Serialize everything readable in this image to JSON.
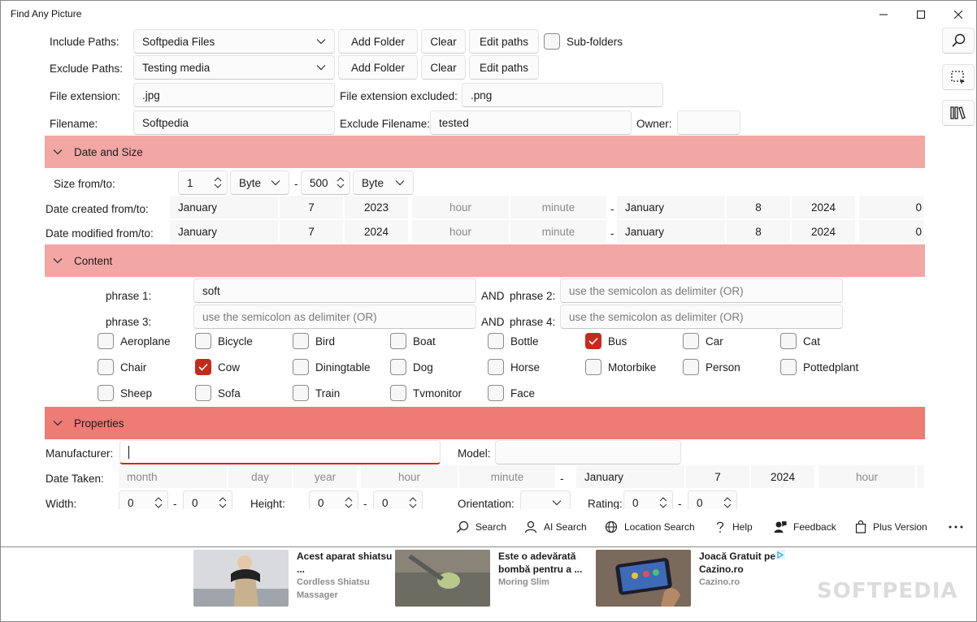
{
  "app": {
    "title": "Find Any Picture"
  },
  "paths": {
    "include_label": "Include Paths:",
    "include_value": "Softpedia Files",
    "exclude_label": "Exclude Paths:",
    "exclude_value": "Testing media",
    "add_folder": "Add Folder",
    "clear": "Clear",
    "edit_paths": "Edit paths",
    "subfolders": "Sub-folders"
  },
  "filters": {
    "ext_label": "File extension:",
    "ext_value": ".jpg",
    "ext_excl_label": "File extension excluded:",
    "ext_excl_value": ".png",
    "filename_label": "Filename:",
    "filename_value": "Softpedia",
    "excl_filename_label": "Exclude Filename:",
    "excl_filename_value": "tested",
    "owner_label": "Owner:",
    "owner_value": ""
  },
  "date_size": {
    "header": "Date and Size",
    "size_label": "Size from/to:",
    "size_from": "1",
    "size_from_unit": "Byte",
    "size_to": "500",
    "size_to_unit": "Byte",
    "dash": "-",
    "created_label": "Date created from/to:",
    "created_from": {
      "month": "January",
      "day": "7",
      "year": "2023",
      "hour": "hour",
      "minute": "minute"
    },
    "created_to": {
      "month": "January",
      "day": "8",
      "year": "2024",
      "hour": "0"
    },
    "modified_label": "Date modified from/to:",
    "modified_from": {
      "month": "January",
      "day": "7",
      "year": "2024",
      "hour": "hour",
      "minute": "minute"
    },
    "modified_to": {
      "month": "January",
      "day": "8",
      "year": "2024",
      "hour": "0"
    }
  },
  "content": {
    "header": "Content",
    "phrase1_label": "phrase 1:",
    "phrase1_value": "soft",
    "and_label": "AND",
    "phrase2_label": "phrase 2:",
    "phrase3_label": "phrase 3:",
    "phrase4_label": "phrase 4:",
    "placeholder": "use the semicolon as delimiter (OR)",
    "objects": [
      {
        "label": "Aeroplane",
        "checked": false
      },
      {
        "label": "Bicycle",
        "checked": false
      },
      {
        "label": "Bird",
        "checked": false
      },
      {
        "label": "Boat",
        "checked": false
      },
      {
        "label": "Bottle",
        "checked": false
      },
      {
        "label": "Bus",
        "checked": true
      },
      {
        "label": "Car",
        "checked": false
      },
      {
        "label": "Cat",
        "checked": false
      },
      {
        "label": "Chair",
        "checked": false
      },
      {
        "label": "Cow",
        "checked": true
      },
      {
        "label": "Diningtable",
        "checked": false
      },
      {
        "label": "Dog",
        "checked": false
      },
      {
        "label": "Horse",
        "checked": false
      },
      {
        "label": "Motorbike",
        "checked": false
      },
      {
        "label": "Person",
        "checked": false
      },
      {
        "label": "Pottedplant",
        "checked": false
      },
      {
        "label": "Sheep",
        "checked": false
      },
      {
        "label": "Sofa",
        "checked": false
      },
      {
        "label": "Train",
        "checked": false
      },
      {
        "label": "Tvmonitor",
        "checked": false
      },
      {
        "label": "Face",
        "checked": false
      }
    ]
  },
  "properties": {
    "header": "Properties",
    "manufacturer_label": "Manufacturer:",
    "manufacturer_value": "",
    "model_label": "Model:",
    "model_value": "",
    "date_taken_label": "Date Taken:",
    "taken_from": {
      "month": "month",
      "day": "day",
      "year": "year",
      "hour": "hour",
      "minute": "minute"
    },
    "taken_to": {
      "month": "January",
      "day": "7",
      "year": "2024",
      "hour": "hour"
    },
    "width_label": "Width:",
    "width_from": "0",
    "width_to": "0",
    "height_label": "Height:",
    "height_from": "0",
    "height_to": "0",
    "orientation_label": "Orientation:",
    "orientation_value": "",
    "rating_label": "Rating:",
    "rating_from": "0",
    "rating_to": "0"
  },
  "bottom": {
    "search": "Search",
    "ai_search": "AI Search",
    "location_search": "Location Search",
    "help": "Help",
    "feedback": "Feedback",
    "plus_version": "Plus Version"
  },
  "ads": [
    {
      "title": "Acest aparat shiatsu ...",
      "source": "Cordless Shiatsu Massager"
    },
    {
      "title": "Este o adevărată bombă pentru a ...",
      "source": "Moring Slim"
    },
    {
      "title": "Joacă Gratuit pe Cazino.ro",
      "source": "Cazino.ro"
    }
  ],
  "watermark": "SOFTPEDIA",
  "colors": {
    "section_light": "#f2a7a4",
    "section_dark": "#ee7b74",
    "check": "#c42b1c"
  }
}
